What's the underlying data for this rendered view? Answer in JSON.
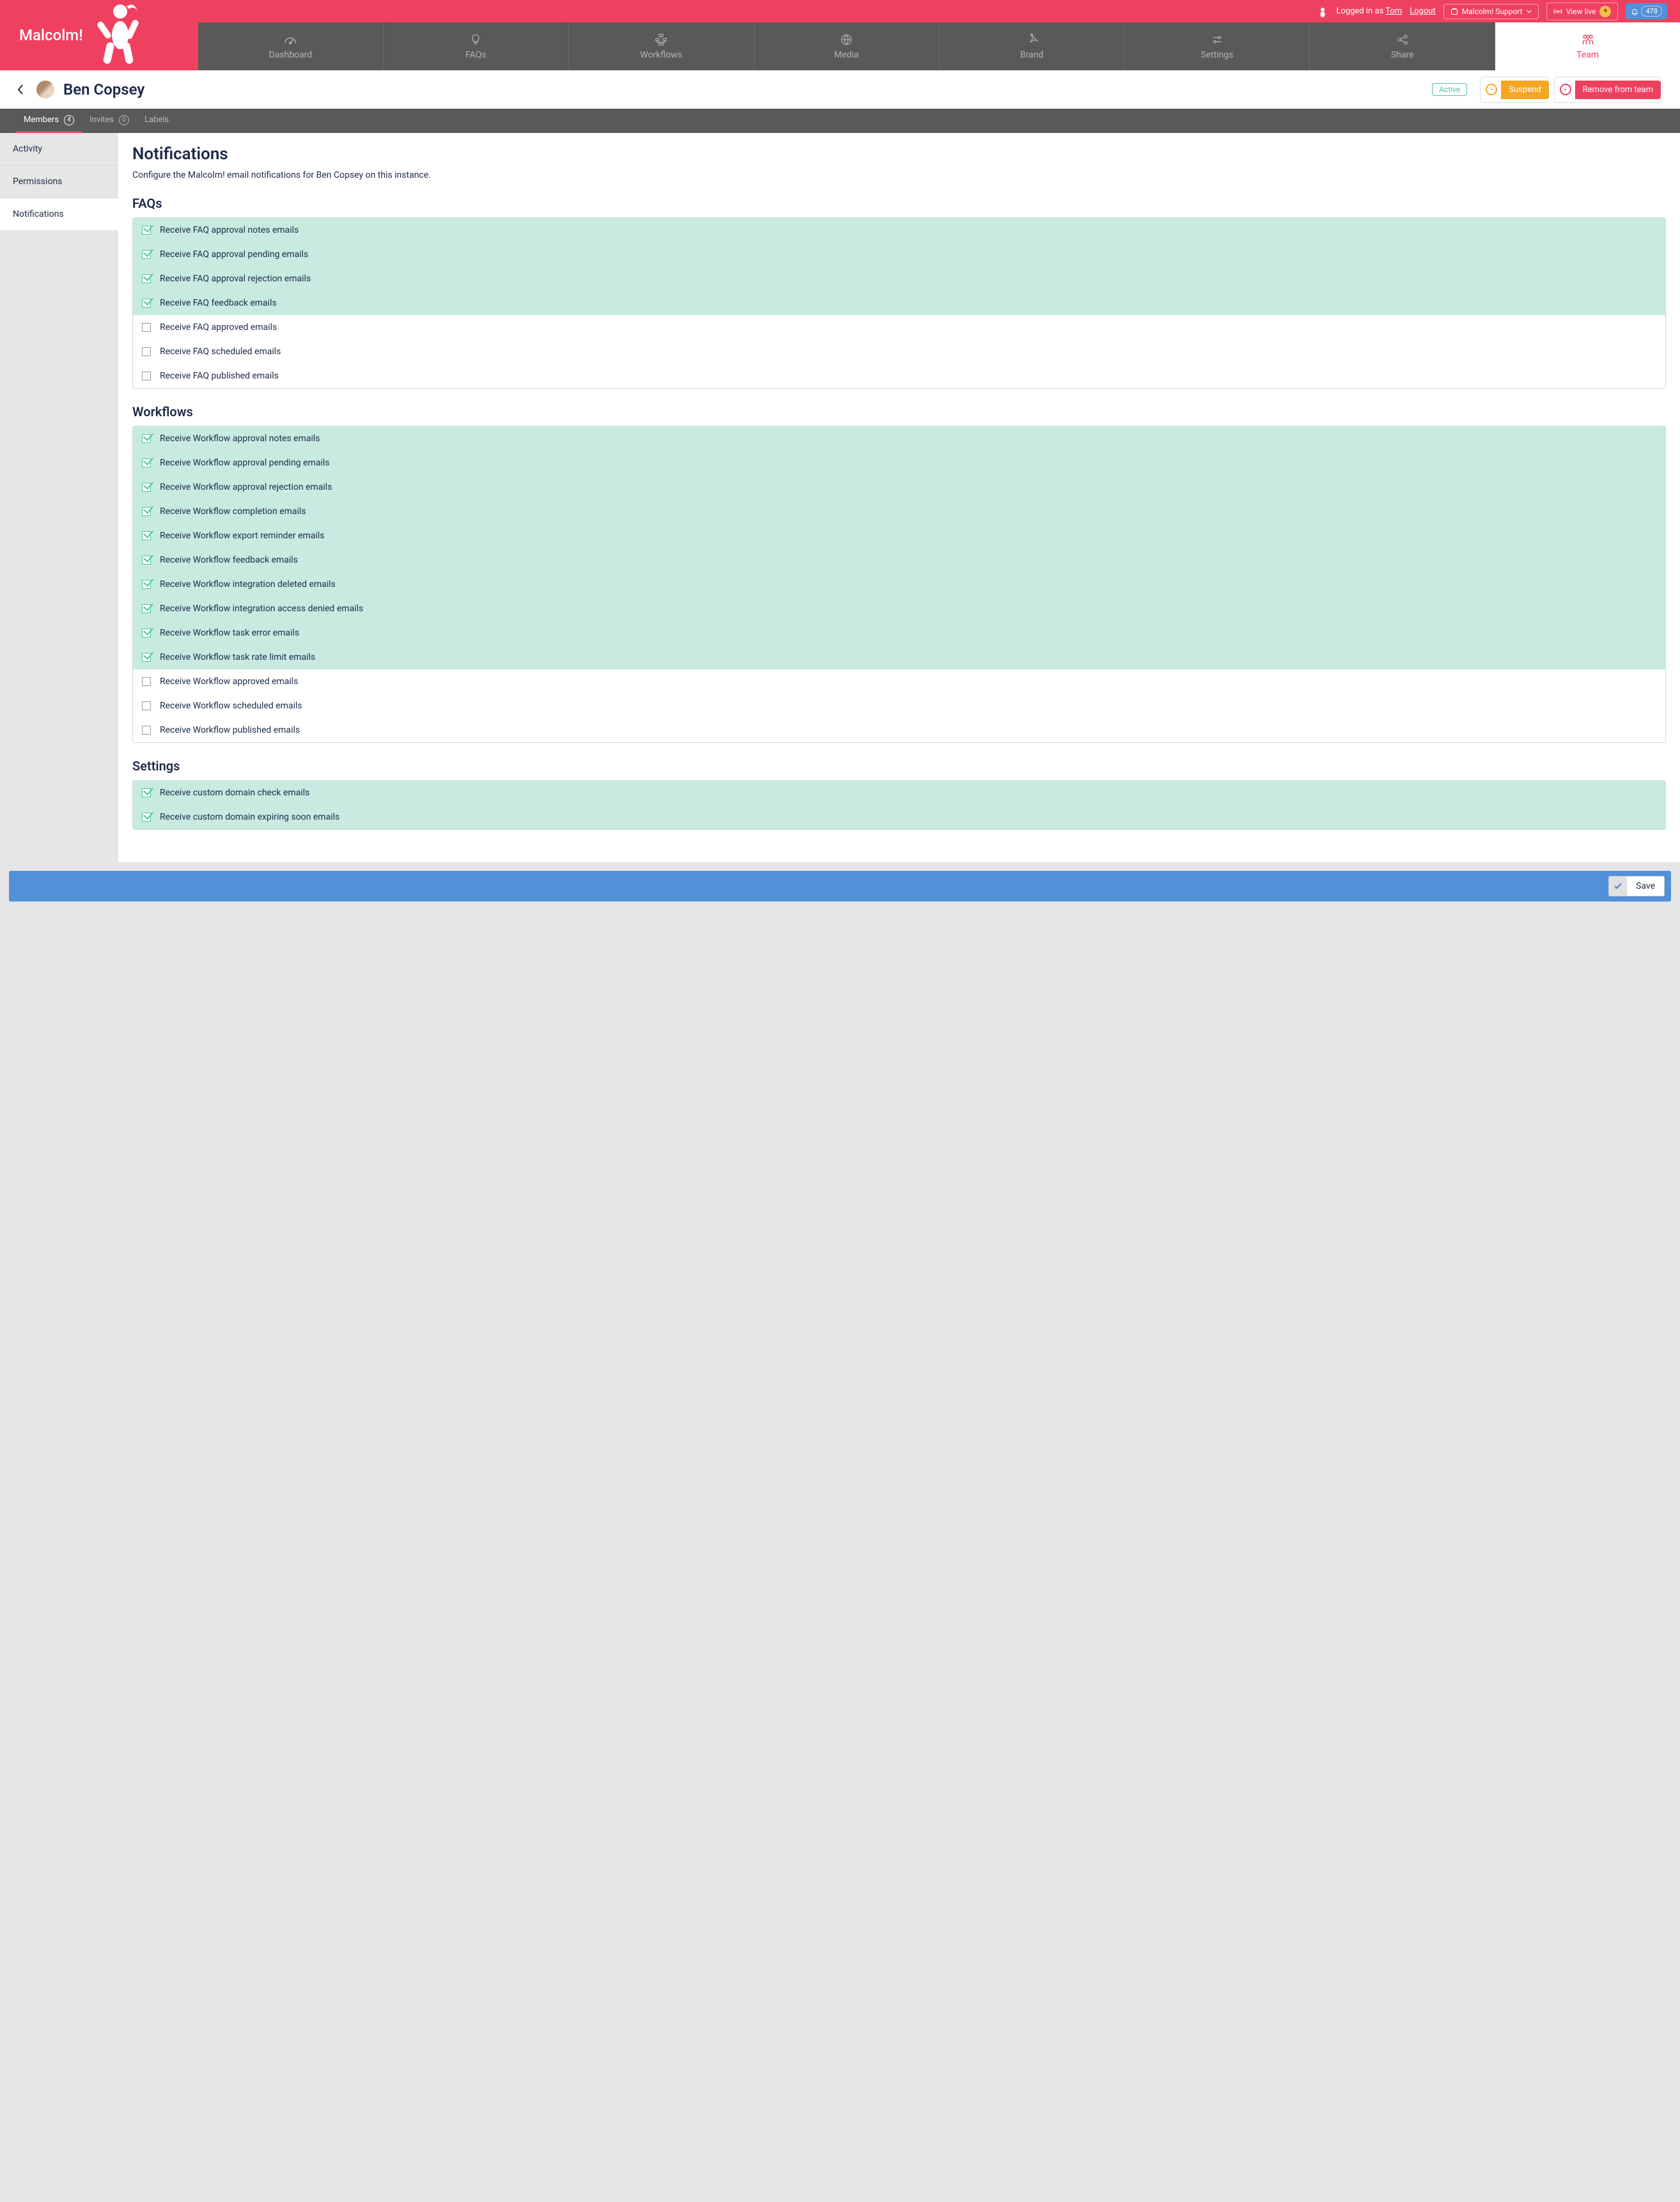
{
  "header": {
    "brand": "Malcolm!",
    "logged_in_prefix": "Logged in as ",
    "username": "Tom",
    "logout": "Logout",
    "support_label": "Malcolm! Support",
    "view_live": "View live",
    "notif_count": "478"
  },
  "nav": {
    "items": [
      {
        "label": "Dashboard"
      },
      {
        "label": "FAQs"
      },
      {
        "label": "Workflows"
      },
      {
        "label": "Media"
      },
      {
        "label": "Brand"
      },
      {
        "label": "Settings"
      },
      {
        "label": "Share"
      },
      {
        "label": "Team"
      }
    ]
  },
  "page": {
    "title": "Ben Copsey",
    "status": "Active",
    "suspend": "Suspend",
    "remove": "Remove from team"
  },
  "subtabs": {
    "members": {
      "label": "Members",
      "count": "4"
    },
    "invites": {
      "label": "Invites",
      "count": "0"
    },
    "labels": {
      "label": "Labels"
    }
  },
  "sidebar": {
    "items": [
      {
        "label": "Activity"
      },
      {
        "label": "Permissions"
      },
      {
        "label": "Notifications"
      }
    ]
  },
  "content": {
    "heading": "Notifications",
    "description": "Configure the Malcolm! email notifications for Ben Copsey on this instance.",
    "sections": [
      {
        "title": "FAQs",
        "items": [
          {
            "label": "Receive FAQ approval notes emails",
            "checked": true
          },
          {
            "label": "Receive FAQ approval pending emails",
            "checked": true
          },
          {
            "label": "Receive FAQ approval rejection emails",
            "checked": true
          },
          {
            "label": "Receive FAQ feedback emails",
            "checked": true
          },
          {
            "label": "Receive FAQ approved emails",
            "checked": false
          },
          {
            "label": "Receive FAQ scheduled emails",
            "checked": false
          },
          {
            "label": "Receive FAQ published emails",
            "checked": false
          }
        ]
      },
      {
        "title": "Workflows",
        "items": [
          {
            "label": "Receive Workflow approval notes emails",
            "checked": true
          },
          {
            "label": "Receive Workflow approval pending emails",
            "checked": true
          },
          {
            "label": "Receive Workflow approval rejection emails",
            "checked": true
          },
          {
            "label": "Receive Workflow completion emails",
            "checked": true
          },
          {
            "label": "Receive Workflow export reminder emails",
            "checked": true
          },
          {
            "label": "Receive Workflow feedback emails",
            "checked": true
          },
          {
            "label": "Receive Workflow integration deleted emails",
            "checked": true
          },
          {
            "label": "Receive Workflow integration access denied emails",
            "checked": true
          },
          {
            "label": "Receive Workflow task error emails",
            "checked": true
          },
          {
            "label": "Receive Workflow task rate limit emails",
            "checked": true
          },
          {
            "label": "Receive Workflow approved emails",
            "checked": false
          },
          {
            "label": "Receive Workflow scheduled emails",
            "checked": false
          },
          {
            "label": "Receive Workflow published emails",
            "checked": false
          }
        ]
      },
      {
        "title": "Settings",
        "items": [
          {
            "label": "Receive custom domain check emails",
            "checked": true
          },
          {
            "label": "Receive custom domain expiring soon emails",
            "checked": true
          }
        ]
      }
    ]
  },
  "savebar": {
    "save": "Save"
  }
}
